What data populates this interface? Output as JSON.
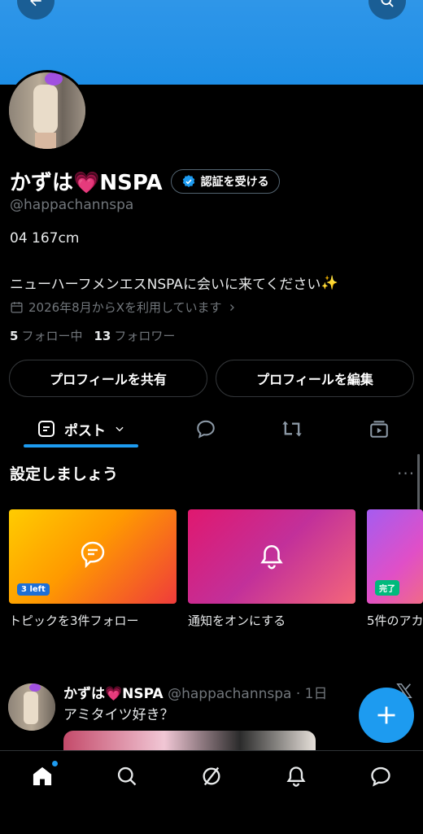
{
  "header": {
    "back_icon": "arrow-left-icon",
    "search_icon": "search-icon",
    "banner_color": "#1d8ee6"
  },
  "profile": {
    "name": "かずは",
    "name_suffix": "NSPA",
    "verify_label": "認証を受ける",
    "handle": "@happachannspa",
    "bio_line1": "04 167cm",
    "bio_line2": "ニューハーフメンエスNSPAに会いに来てください",
    "joined": "2026年8月からXを利用しています",
    "following_count": "5",
    "following_label": "フォロー中",
    "followers_count": "13",
    "followers_label": "フォロワー",
    "share_label": "プロフィールを共有",
    "edit_label": "プロフィールを編集"
  },
  "tabs": {
    "posts_label": "ポスト",
    "accent": "#1d9bf0"
  },
  "setup": {
    "title": "設定しましょう",
    "cards": [
      {
        "label": "トピックを3件フォロー",
        "badge": "3 left"
      },
      {
        "label": "通知をオンにする"
      },
      {
        "label": "5件のアカ",
        "badge": "完了"
      }
    ]
  },
  "post": {
    "name": "かずは",
    "name_suffix": "NSPA",
    "handle_time": "@happachannspa · 1日",
    "text": "アミタイツ好き？"
  },
  "nav": [
    "home-icon",
    "search-icon",
    "grok-icon",
    "bell-icon",
    "messages-icon"
  ]
}
